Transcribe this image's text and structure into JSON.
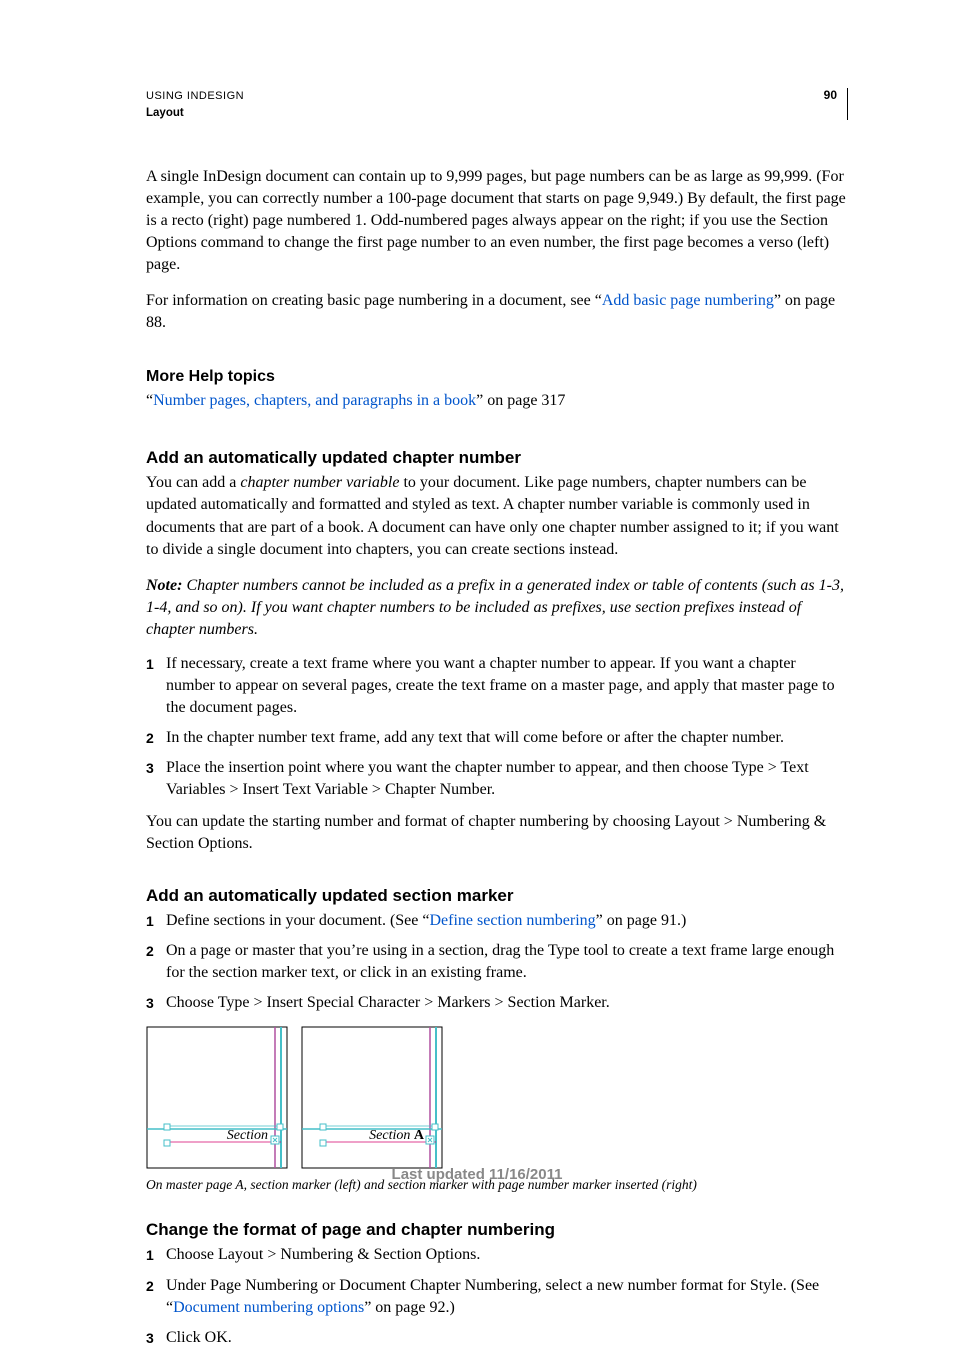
{
  "header": {
    "doc_title": "USING INDESIGN",
    "section": "Layout",
    "page_number": "90"
  },
  "intro": {
    "p1": "A single InDesign document can contain up to 9,999 pages, but page numbers can be as large as 99,999. (For example, you can correctly number a 100-page document that starts on page 9,949.) By default, the first page is a recto (right) page numbered 1. Odd-numbered pages always appear on the right; if you use the Section Options command to change the first page number to an even number, the first page becomes a verso (left) page.",
    "p2_pre": "For information on creating basic page numbering in a document, see “",
    "p2_link": "Add basic page numbering",
    "p2_post": "” on page 88."
  },
  "more_help": {
    "heading": "More Help topics",
    "pre": "“",
    "link": "Number pages, chapters, and paragraphs in a book",
    "post": "” on page 317"
  },
  "chapter": {
    "heading": "Add an automatically updated chapter number",
    "p1_a": "You can add a ",
    "p1_em": "chapter number variable",
    "p1_b": " to your document. Like page numbers, chapter numbers can be updated automatically and formatted and styled as text. A chapter number variable is commonly used in documents that are part of a book. A document can have only one chapter number assigned to it; if you want to divide a single document into chapters, you can create sections instead.",
    "note_label": "Note:",
    "note_body": " Chapter numbers cannot be included as a prefix in a generated index or table of contents (such as 1-3, 1-4, and so on). If you want chapter numbers to be included as prefixes, use section prefixes instead of chapter numbers.",
    "steps": [
      "If necessary, create a text frame where you want a chapter number to appear. If you want a chapter number to appear on several pages, create the text frame on a master page, and apply that master page to the document pages.",
      "In the chapter number text frame, add any text that will come before or after the chapter number.",
      "Place the insertion point where you want the chapter number to appear, and then choose Type > Text Variables > Insert Text Variable > Chapter Number."
    ],
    "p2": "You can update the starting number and format of chapter numbering by choosing Layout > Numbering & Section Options."
  },
  "section_marker": {
    "heading": "Add an automatically updated section marker",
    "step1_a": "Define sections in your document. (See “",
    "step1_link": "Define section numbering",
    "step1_b": "” on page 91.)",
    "step2": "On a page or master that you’re using in a section, drag the Type tool to create a text frame large enough for the section marker text, or click in an existing frame.",
    "step3": "Choose Type > Insert Special Character > Markers > Section Marker.",
    "fig_left": "Section",
    "fig_right_a": "Section ",
    "fig_right_b": "A",
    "caption": "On master page A, section marker (left) and section marker with page number marker inserted (right)"
  },
  "format": {
    "heading": "Change the format of page and chapter numbering",
    "step1": "Choose Layout > Numbering & Section Options.",
    "step2_a": "Under Page Numbering or Document Chapter Numbering, select a new number format for Style. (See “",
    "step2_link": "Document numbering options",
    "step2_b": "” on page 92.)",
    "step3": "Click OK."
  },
  "footer": "Last updated 11/16/2011",
  "nums": {
    "n1": "1",
    "n2": "2",
    "n3": "3"
  }
}
